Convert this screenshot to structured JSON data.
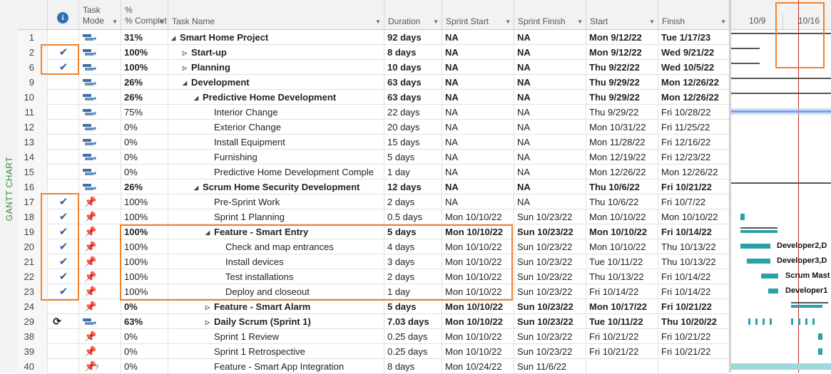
{
  "view_label": "GANTT CHART",
  "columns": {
    "info_icon": "info-icon",
    "task_mode": "Task Mode",
    "complete": "% Complet",
    "task_name": "Task Name",
    "duration": "Duration",
    "sprint_start": "Sprint Start",
    "sprint_finish": "Sprint Finish",
    "start": "Start",
    "finish": "Finish"
  },
  "timescale": {
    "dates": [
      "10/9",
      "10/16"
    ]
  },
  "colors": {
    "highlight": "#f0812d",
    "gantt_bar": "#2aa1a6",
    "today_line": "#c02828",
    "check": "#2d5f9e",
    "pin": "#35b3d3"
  },
  "rows": [
    {
      "id": "1",
      "done": false,
      "mode": "auto",
      "pct": "31%",
      "name": "Smart Home Project",
      "indent": 0,
      "toggle": "expanded",
      "bold": true,
      "duration": "92 days",
      "sprint_start": "NA",
      "sprint_finish": "NA",
      "start": "Mon 9/12/22",
      "finish": "Tue 1/17/23"
    },
    {
      "id": "2",
      "done": true,
      "mode": "auto",
      "pct": "100%",
      "name": "Start-up",
      "indent": 1,
      "toggle": "collapsed",
      "bold": true,
      "duration": "8 days",
      "sprint_start": "NA",
      "sprint_finish": "NA",
      "start": "Mon 9/12/22",
      "finish": "Wed 9/21/22"
    },
    {
      "id": "6",
      "done": true,
      "mode": "auto",
      "pct": "100%",
      "name": "Planning",
      "indent": 1,
      "toggle": "collapsed",
      "bold": true,
      "duration": "10 days",
      "sprint_start": "NA",
      "sprint_finish": "NA",
      "start": "Thu 9/22/22",
      "finish": "Wed 10/5/22"
    },
    {
      "id": "9",
      "done": false,
      "mode": "auto",
      "pct": "26%",
      "name": "Development",
      "indent": 1,
      "toggle": "expanded",
      "bold": true,
      "duration": "63 days",
      "sprint_start": "NA",
      "sprint_finish": "NA",
      "start": "Thu 9/29/22",
      "finish": "Mon 12/26/22"
    },
    {
      "id": "10",
      "done": false,
      "mode": "auto",
      "pct": "26%",
      "name": "Predictive Home Development",
      "indent": 2,
      "toggle": "expanded",
      "bold": true,
      "duration": "63 days",
      "sprint_start": "NA",
      "sprint_finish": "NA",
      "start": "Thu 9/29/22",
      "finish": "Mon 12/26/22"
    },
    {
      "id": "11",
      "done": false,
      "mode": "auto",
      "pct": "75%",
      "name": "Interior Change",
      "indent": 3,
      "toggle": "",
      "bold": false,
      "duration": "22 days",
      "sprint_start": "NA",
      "sprint_finish": "NA",
      "start": "Thu 9/29/22",
      "finish": "Fri 10/28/22"
    },
    {
      "id": "12",
      "done": false,
      "mode": "auto",
      "pct": "0%",
      "name": "Exterior Change",
      "indent": 3,
      "toggle": "",
      "bold": false,
      "duration": "20 days",
      "sprint_start": "NA",
      "sprint_finish": "NA",
      "start": "Mon 10/31/22",
      "finish": "Fri 11/25/22"
    },
    {
      "id": "13",
      "done": false,
      "mode": "auto",
      "pct": "0%",
      "name": "Install Equipment",
      "indent": 3,
      "toggle": "",
      "bold": false,
      "duration": "15 days",
      "sprint_start": "NA",
      "sprint_finish": "NA",
      "start": "Mon 11/28/22",
      "finish": "Fri 12/16/22"
    },
    {
      "id": "14",
      "done": false,
      "mode": "auto",
      "pct": "0%",
      "name": "Furnishing",
      "indent": 3,
      "toggle": "",
      "bold": false,
      "duration": "5 days",
      "sprint_start": "NA",
      "sprint_finish": "NA",
      "start": "Mon 12/19/22",
      "finish": "Fri 12/23/22"
    },
    {
      "id": "15",
      "done": false,
      "mode": "auto",
      "pct": "0%",
      "name": "Predictive Home Development Comple",
      "indent": 3,
      "toggle": "",
      "bold": false,
      "duration": "1 day",
      "sprint_start": "NA",
      "sprint_finish": "NA",
      "start": "Mon 12/26/22",
      "finish": "Mon 12/26/22"
    },
    {
      "id": "16",
      "done": false,
      "mode": "auto",
      "pct": "26%",
      "name": "Scrum Home Security Development",
      "indent": 2,
      "toggle": "expanded",
      "bold": true,
      "duration": "12 days",
      "sprint_start": "NA",
      "sprint_finish": "NA",
      "start": "Thu 10/6/22",
      "finish": "Fri 10/21/22"
    },
    {
      "id": "17",
      "done": true,
      "mode": "manual",
      "pct": "100%",
      "name": "Pre-Sprint Work",
      "indent": 3,
      "toggle": "",
      "bold": false,
      "duration": "2 days",
      "sprint_start": "NA",
      "sprint_finish": "NA",
      "start": "Thu 10/6/22",
      "finish": "Fri 10/7/22"
    },
    {
      "id": "18",
      "done": true,
      "mode": "manual",
      "pct": "100%",
      "name": "Sprint 1 Planning",
      "indent": 3,
      "toggle": "",
      "bold": false,
      "duration": "0.5 days",
      "sprint_start": "Mon 10/10/22",
      "sprint_finish": "Sun 10/23/22",
      "start": "Mon 10/10/22",
      "finish": "Mon 10/10/22"
    },
    {
      "id": "19",
      "done": true,
      "mode": "manual",
      "pct": "100%",
      "name": "Feature - Smart Entry",
      "indent": 3,
      "toggle": "expanded",
      "bold": true,
      "duration": "5 days",
      "sprint_start": "Mon 10/10/22",
      "sprint_finish": "Sun 10/23/22",
      "start": "Mon 10/10/22",
      "finish": "Fri 10/14/22"
    },
    {
      "id": "20",
      "done": true,
      "mode": "manual",
      "pct": "100%",
      "name": "Check and map entrances",
      "indent": 4,
      "toggle": "",
      "bold": false,
      "duration": "4 days",
      "sprint_start": "Mon 10/10/22",
      "sprint_finish": "Sun 10/23/22",
      "start": "Mon 10/10/22",
      "finish": "Thu 10/13/22"
    },
    {
      "id": "21",
      "done": true,
      "mode": "manual",
      "pct": "100%",
      "name": "Install devices",
      "indent": 4,
      "toggle": "",
      "bold": false,
      "duration": "3 days",
      "sprint_start": "Mon 10/10/22",
      "sprint_finish": "Sun 10/23/22",
      "start": "Tue 10/11/22",
      "finish": "Thu 10/13/22"
    },
    {
      "id": "22",
      "done": true,
      "mode": "manual",
      "pct": "100%",
      "name": "Test installations",
      "indent": 4,
      "toggle": "",
      "bold": false,
      "duration": "2 days",
      "sprint_start": "Mon 10/10/22",
      "sprint_finish": "Sun 10/23/22",
      "start": "Thu 10/13/22",
      "finish": "Fri 10/14/22"
    },
    {
      "id": "23",
      "done": true,
      "mode": "manual",
      "pct": "100%",
      "name": "Deploy and closeout",
      "indent": 4,
      "toggle": "",
      "bold": false,
      "duration": "1 day",
      "sprint_start": "Mon 10/10/22",
      "sprint_finish": "Sun 10/23/22",
      "start": "Fri 10/14/22",
      "finish": "Fri 10/14/22"
    },
    {
      "id": "24",
      "done": false,
      "mode": "manual",
      "pct": "0%",
      "name": "Feature - Smart Alarm",
      "indent": 3,
      "toggle": "collapsed",
      "bold": true,
      "duration": "5 days",
      "sprint_start": "Mon 10/10/22",
      "sprint_finish": "Sun 10/23/22",
      "start": "Mon 10/17/22",
      "finish": "Fri 10/21/22"
    },
    {
      "id": "29",
      "done": false,
      "recurring": true,
      "mode": "auto",
      "pct": "63%",
      "name": "Daily Scrum (Sprint 1)",
      "indent": 3,
      "toggle": "collapsed",
      "bold": true,
      "duration": "7.03 days",
      "sprint_start": "Mon 10/10/22",
      "sprint_finish": "Sun 10/23/22",
      "start": "Tue 10/11/22",
      "finish": "Thu 10/20/22"
    },
    {
      "id": "38",
      "done": false,
      "mode": "manual",
      "pct": "0%",
      "name": "Sprint 1 Review",
      "indent": 3,
      "toggle": "",
      "bold": false,
      "duration": "0.25 days",
      "sprint_start": "Mon 10/10/22",
      "sprint_finish": "Sun 10/23/22",
      "start": "Fri 10/21/22",
      "finish": "Fri 10/21/22"
    },
    {
      "id": "39",
      "done": false,
      "mode": "manual",
      "pct": "0%",
      "name": "Sprint 1 Retrospective",
      "indent": 3,
      "toggle": "",
      "bold": false,
      "duration": "0.25 days",
      "sprint_start": "Mon 10/10/22",
      "sprint_finish": "Sun 10/23/22",
      "start": "Fri 10/21/22",
      "finish": "Fri 10/21/22"
    },
    {
      "id": "40",
      "done": false,
      "mode": "manual-estimated",
      "pct": "0%",
      "name": "Feature - Smart App Integration",
      "indent": 3,
      "toggle": "",
      "bold": false,
      "duration": "8 days",
      "sprint_start": "Mon 10/24/22",
      "sprint_finish": "Sun 11/6/22",
      "start": "",
      "finish": ""
    }
  ],
  "gantt_labels": [
    "Developer2,D",
    "Developer3,D",
    "Scrum Mast",
    "Developer1"
  ]
}
